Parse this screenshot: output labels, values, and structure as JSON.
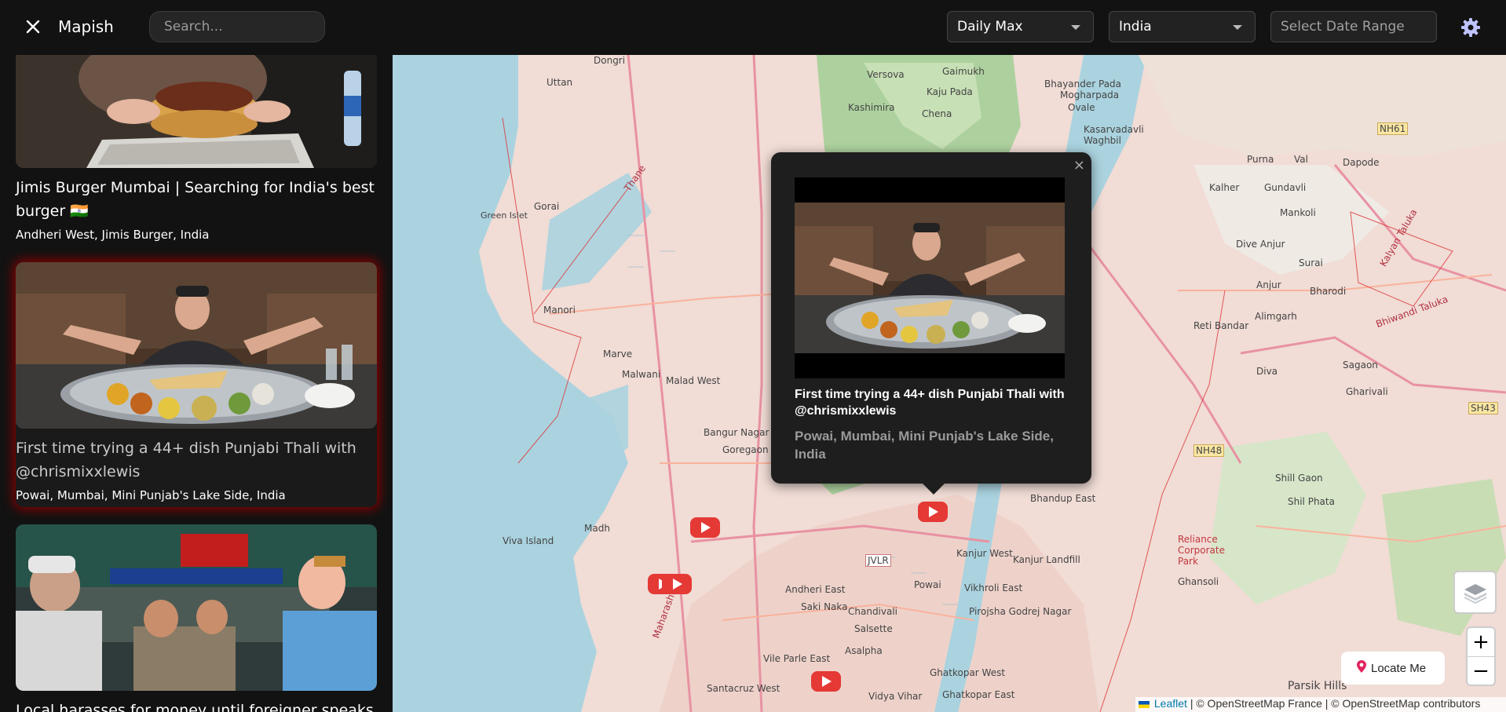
{
  "header": {
    "close_icon": "close-icon",
    "brand": "Mapish",
    "search_placeholder": "Search...",
    "metric_select": "Daily Max",
    "country_select": "India",
    "date_range_placeholder": "Select Date Range",
    "settings_icon": "gear-icon"
  },
  "sidebar": {
    "items": [
      {
        "title": "Jimis Burger Mumbai | Searching for India's best burger 🇮🇳",
        "location": "Andheri West, Jimis Burger, India",
        "active": false
      },
      {
        "title": "First time trying a 44+ dish Punjabi Thali with @chrismixxlewis",
        "location": "Powai, Mumbai, Mini Punjab's Lake Side, India",
        "active": true
      },
      {
        "title": "Local harasses for money until foreigner speaks",
        "location": "",
        "active": false
      }
    ]
  },
  "map": {
    "labels": [
      "Dongri",
      "Uttan",
      "Versova",
      "Gaimukh",
      "Kaju Pada",
      "Chena",
      "Kashimira",
      "Bhayander Pada",
      "Mogharpada",
      "Ovale",
      "Kasarvadavli",
      "Waghbil",
      "Purna",
      "Val",
      "Dapode",
      "Gundavli",
      "Mankoli",
      "Kalher",
      "Dive Anjur",
      "Surai",
      "Anjur",
      "Bharodi",
      "Alimgarh",
      "Gorai",
      "Green Islet",
      "Manori",
      "Marve",
      "Malwani",
      "Malad West",
      "Bangur Nagar",
      "Goregaon",
      "Madh",
      "Viva Island",
      "Reti Bandar",
      "Diva",
      "Sagaon",
      "Gharivali",
      "Shill Gaon",
      "Shil Phata",
      "Reliance Corporate Park",
      "Ghansoli",
      "Parsik Hills",
      "JVLR",
      "Kanjur West",
      "Vikhroli East",
      "Bhandup East",
      "Powai",
      "Chandivali",
      "Andheri East",
      "Saki Naka",
      "Vile Parle East",
      "Santacruz West",
      "Ghatkopar West",
      "Ghatkopar East",
      "Vidya Vihar",
      "Pirojsha Godrej Nagar",
      "Kanjur Landfill",
      "Asalpha",
      "Salsette",
      "Maharashtra",
      "Thane",
      "NH61",
      "NH48",
      "SH43",
      "Bhiwandi Taluka",
      "Kalyan Taluka"
    ],
    "popup": {
      "title": "First time trying a 44+ dish Punjabi Thali with @chrismixxlewis",
      "location": "Powai, Mumbai, Mini Punjab's Lake Side, India",
      "close": "×"
    },
    "controls": {
      "locate_label": "Locate Me",
      "zoom_in": "+",
      "zoom_out": "−",
      "layers_icon": "layers-icon"
    },
    "attribution": {
      "leaflet": "Leaflet",
      "rest": " | © OpenStreetMap France | © OpenStreetMap contributors"
    }
  },
  "colors": {
    "accent_marker": "#e53935",
    "active_glow": "#8a0000",
    "water": "#aad3df",
    "urban": "#f1dcd6",
    "forest": "#add19e"
  }
}
